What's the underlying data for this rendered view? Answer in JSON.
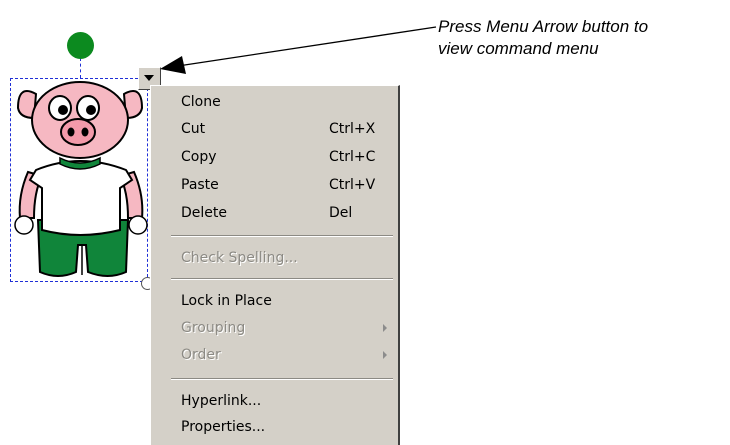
{
  "callout": {
    "line1": "Press Menu Arrow button to",
    "line2": "view command menu"
  },
  "menu_arrow": {
    "icon": "triangle-down-icon"
  },
  "menu": {
    "items": [
      {
        "label": "Clone",
        "shortcut": "",
        "enabled": true
      },
      {
        "label": "Cut",
        "shortcut": "Ctrl+X",
        "enabled": true
      },
      {
        "label": "Copy",
        "shortcut": "Ctrl+C",
        "enabled": true
      },
      {
        "label": "Paste",
        "shortcut": "Ctrl+V",
        "enabled": true
      },
      {
        "label": "Delete",
        "shortcut": "Del",
        "enabled": true
      },
      {
        "label": "Check Spelling...",
        "shortcut": "",
        "enabled": false
      },
      {
        "label": "Lock in Place",
        "shortcut": "",
        "enabled": true
      },
      {
        "label": "Grouping",
        "shortcut": "",
        "enabled": false,
        "submenu": true
      },
      {
        "label": "Order",
        "shortcut": "",
        "enabled": false,
        "submenu": true
      },
      {
        "label": "Hyperlink...",
        "shortcut": "",
        "enabled": true
      },
      {
        "label": "Properties...",
        "shortcut": "",
        "enabled": true
      }
    ]
  },
  "colors": {
    "selection_border": "#1f2fd6",
    "rotate_handle": "#0c8a1f",
    "menu_background": "#d4d0c8",
    "disabled_text": "#8c8a84"
  },
  "object": {
    "type": "pig-clipart"
  }
}
